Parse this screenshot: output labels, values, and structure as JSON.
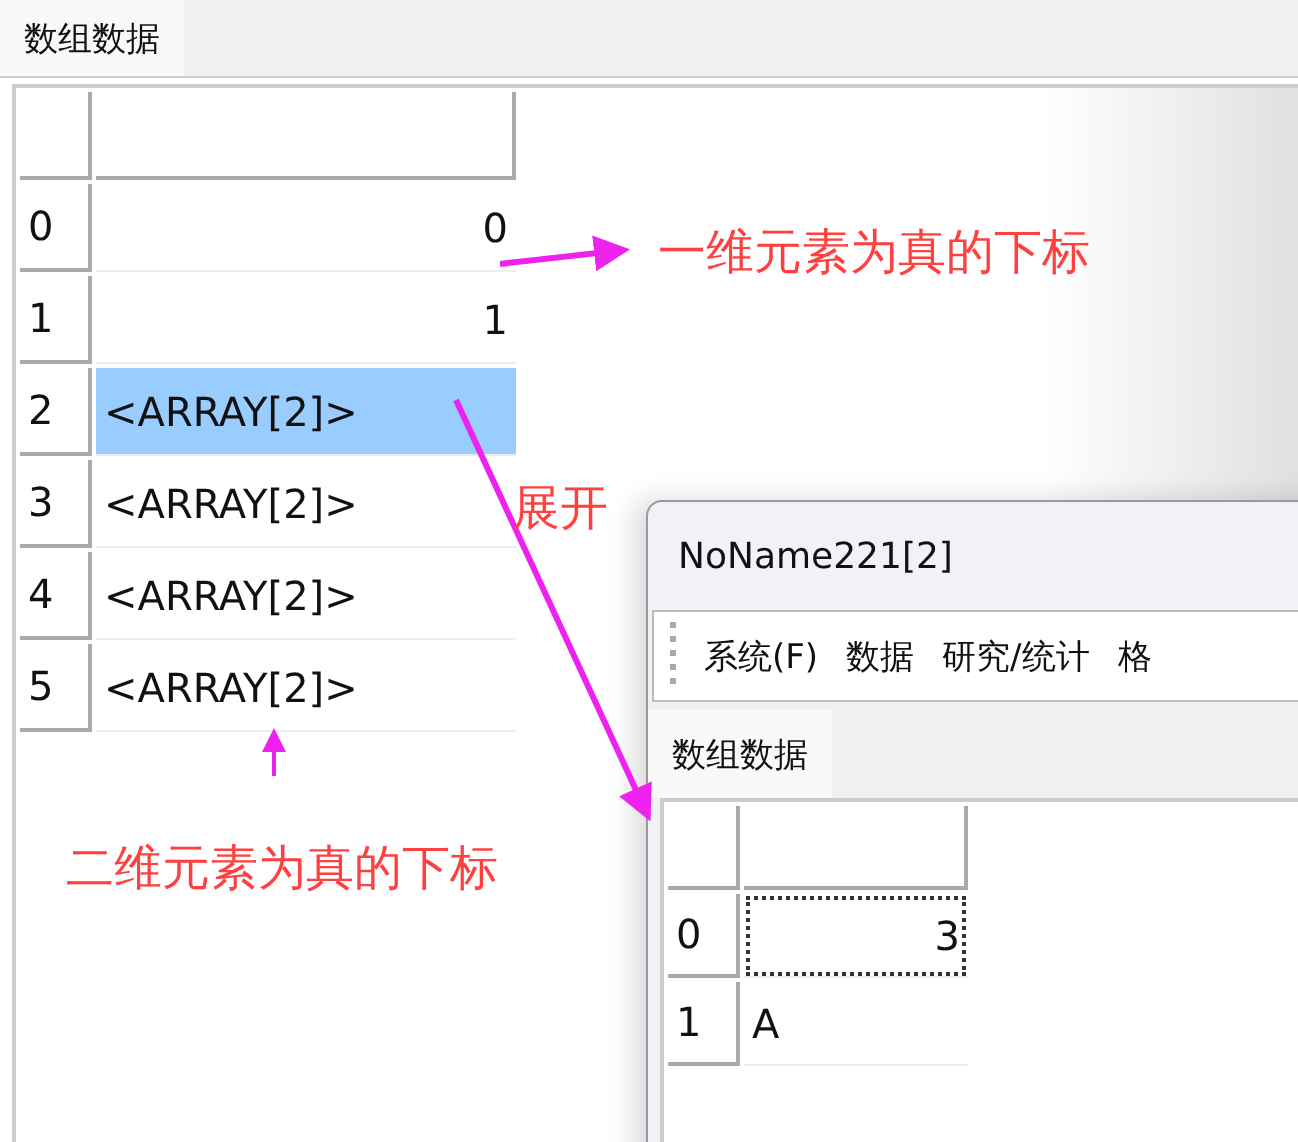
{
  "main": {
    "tab": {
      "label": "数组数据",
      "selected": true
    },
    "rows": [
      {
        "index": "0",
        "value": "0",
        "kind": "number",
        "selected": false,
        "focused": false
      },
      {
        "index": "1",
        "value": "1",
        "kind": "number",
        "selected": false,
        "focused": false
      },
      {
        "index": "2",
        "value": "<ARRAY[2]>",
        "kind": "array",
        "selected": true,
        "focused": false
      },
      {
        "index": "3",
        "value": "<ARRAY[2]>",
        "kind": "array",
        "selected": false,
        "focused": false
      },
      {
        "index": "4",
        "value": "<ARRAY[2]>",
        "kind": "array",
        "selected": false,
        "focused": false
      },
      {
        "index": "5",
        "value": "<ARRAY[2]>",
        "kind": "array",
        "selected": false,
        "focused": false
      }
    ]
  },
  "annotations": [
    {
      "text": "一维元素为真的下标"
    },
    {
      "text": "展开"
    },
    {
      "text": "二维元素为真的下标"
    }
  ],
  "child_window": {
    "title": "NoName221[2]",
    "menu": [
      "系统(F)",
      "数据",
      "研究/统计",
      "格"
    ],
    "tab": {
      "label": "数组数据",
      "selected": true
    },
    "rows": [
      {
        "index": "0",
        "value": "3",
        "kind": "number",
        "selected": false,
        "focused": true
      },
      {
        "index": "1",
        "value": "A",
        "kind": "string",
        "selected": false,
        "focused": false
      }
    ]
  }
}
